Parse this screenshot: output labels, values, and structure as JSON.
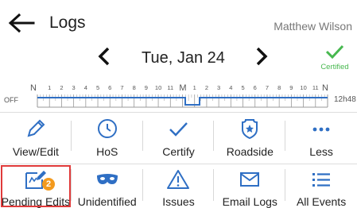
{
  "header": {
    "title": "Logs",
    "user_name": "Matthew Wilson"
  },
  "date_nav": {
    "date": "Tue, Jan 24"
  },
  "certified": {
    "label": "Certified",
    "color": "#47b84f"
  },
  "graph": {
    "start_label": "N",
    "mid_label": "M",
    "end_label": "N",
    "hour_labels": [
      "1",
      "2",
      "3",
      "4",
      "5",
      "6",
      "7",
      "8",
      "9",
      "10",
      "11"
    ],
    "off_label": "OFF",
    "total_label": "12h48",
    "line_color": "#2f6fc4"
  },
  "actions_row1": [
    {
      "label": "View/Edit",
      "icon": "pencil-icon"
    },
    {
      "label": "HoS",
      "icon": "clock-icon"
    },
    {
      "label": "Certify",
      "icon": "check-icon"
    },
    {
      "label": "Roadside",
      "icon": "badge-icon"
    },
    {
      "label": "Less",
      "icon": "more-dots-icon"
    }
  ],
  "actions_row2": [
    {
      "label": "Pending Edits",
      "icon": "edit-doc-icon",
      "badge": "2"
    },
    {
      "label": "Unidentified",
      "icon": "mask-icon"
    },
    {
      "label": "Issues",
      "icon": "warning-icon"
    },
    {
      "label": "Email Logs",
      "icon": "envelope-icon"
    },
    {
      "label": "All Events",
      "icon": "list-icon"
    }
  ],
  "colors": {
    "icon": "#2f6fc4",
    "badge": "#f39a1e",
    "highlight": "#e03a3a"
  }
}
